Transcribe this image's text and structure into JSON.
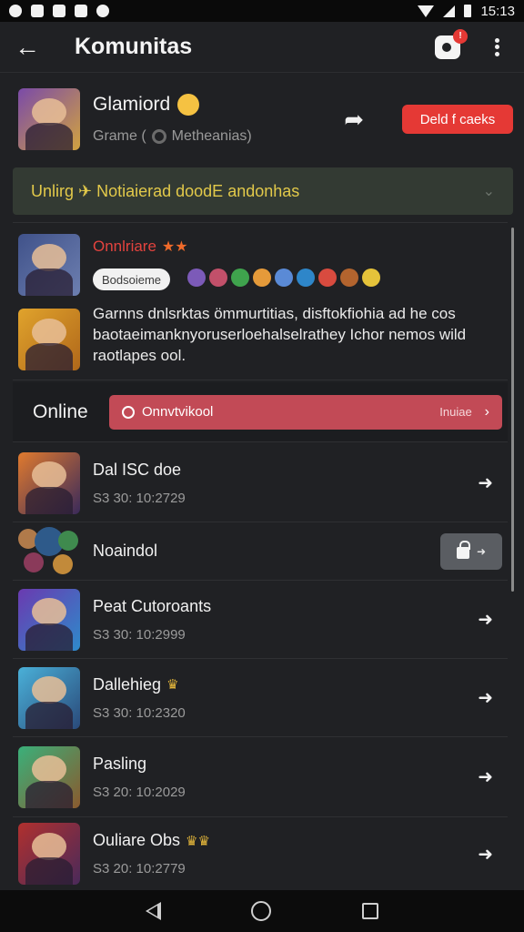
{
  "status_bar": {
    "time": "15:13"
  },
  "app_bar": {
    "title": "Komunitas",
    "notification_badge": "!"
  },
  "community": {
    "name": "Glamiord",
    "meta_left": "Grame (",
    "meta_right": "Metheanias)",
    "join_label": "Deld f caeks"
  },
  "notice": {
    "text": "Unlirg ✈ Notiaierad doodE andonhas"
  },
  "post": {
    "title": "Onnlriare",
    "stars": "★★",
    "tag": "Bodsoieme",
    "body": "Garnns dnlsrktas ömmurtitias, disftokfiohia ad he cos baotaeimanknyoruserloehalselrathey Ichor nemos wild raotlapes ool."
  },
  "online": {
    "label": "Online",
    "button_label": "Onnvtvikool",
    "button_action": "Inuiae"
  },
  "members": [
    {
      "name": "Dal ISC doe",
      "time": "S3 30: 10:2729"
    },
    {
      "name": "Noaindol"
    },
    {
      "name": "Peat Cutoroants",
      "time": "S3 30: 10:2999"
    },
    {
      "name": "Dallehieg",
      "time": "S3 30: 10:2320"
    },
    {
      "name": "Pasling",
      "time": "S3 20: 10:2029"
    },
    {
      "name": "Ouliare Obs",
      "time": "S3 20: 10:2779"
    }
  ],
  "colors": {
    "accent_red": "#e53935",
    "notice_text": "#e2c94a",
    "online_button": "#c24a56",
    "background": "#202124"
  },
  "icons": {
    "back": "arrow-left-icon",
    "notifications": "bell-icon",
    "menu": "more-vert-icon",
    "share": "share-icon",
    "row_action": "arrow-right-icon",
    "lock": "lock-icon"
  }
}
